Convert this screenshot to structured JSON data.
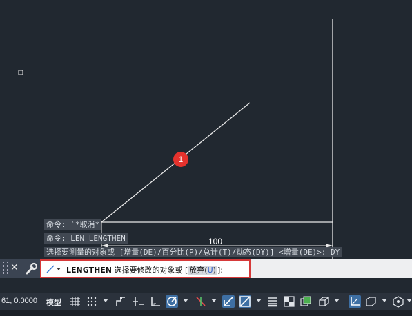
{
  "canvas": {
    "background": "#212830",
    "dimension_text": "100",
    "marker_number": "1",
    "marker_color": "#e5322d"
  },
  "history": {
    "line1": "命令: `*取消*",
    "line2": "命令: LEN LENGTHEN",
    "line3": "选择要测量的对象或 [增量(DE)/百分比(P)/总计(T)/动态(DY)] <增量(DE)>: DY"
  },
  "command": {
    "name": "LENGTHEN",
    "prompt": "选择要修改的对象或 [",
    "option_label": "放弃(",
    "option_key": "U",
    "option_close": ")",
    "suffix": "]:",
    "highlight_color": "#d63a3a"
  },
  "statusbar": {
    "coords": "61, 0.0000",
    "model_tab": "模型",
    "icons": [
      "grid-icon",
      "snap-icon",
      "infer-icon",
      "dynamic-input-icon",
      "ortho-icon",
      "polar-icon",
      "isodraft-icon",
      "object-snap-tracking-icon",
      "object-snap-icon",
      "lineweight-icon",
      "transparency-icon",
      "selection-cycling-icon",
      "3d-osnap-icon",
      "dynamic-ucs-icon",
      "selection-filter-icon",
      "gizmo-icon"
    ]
  }
}
